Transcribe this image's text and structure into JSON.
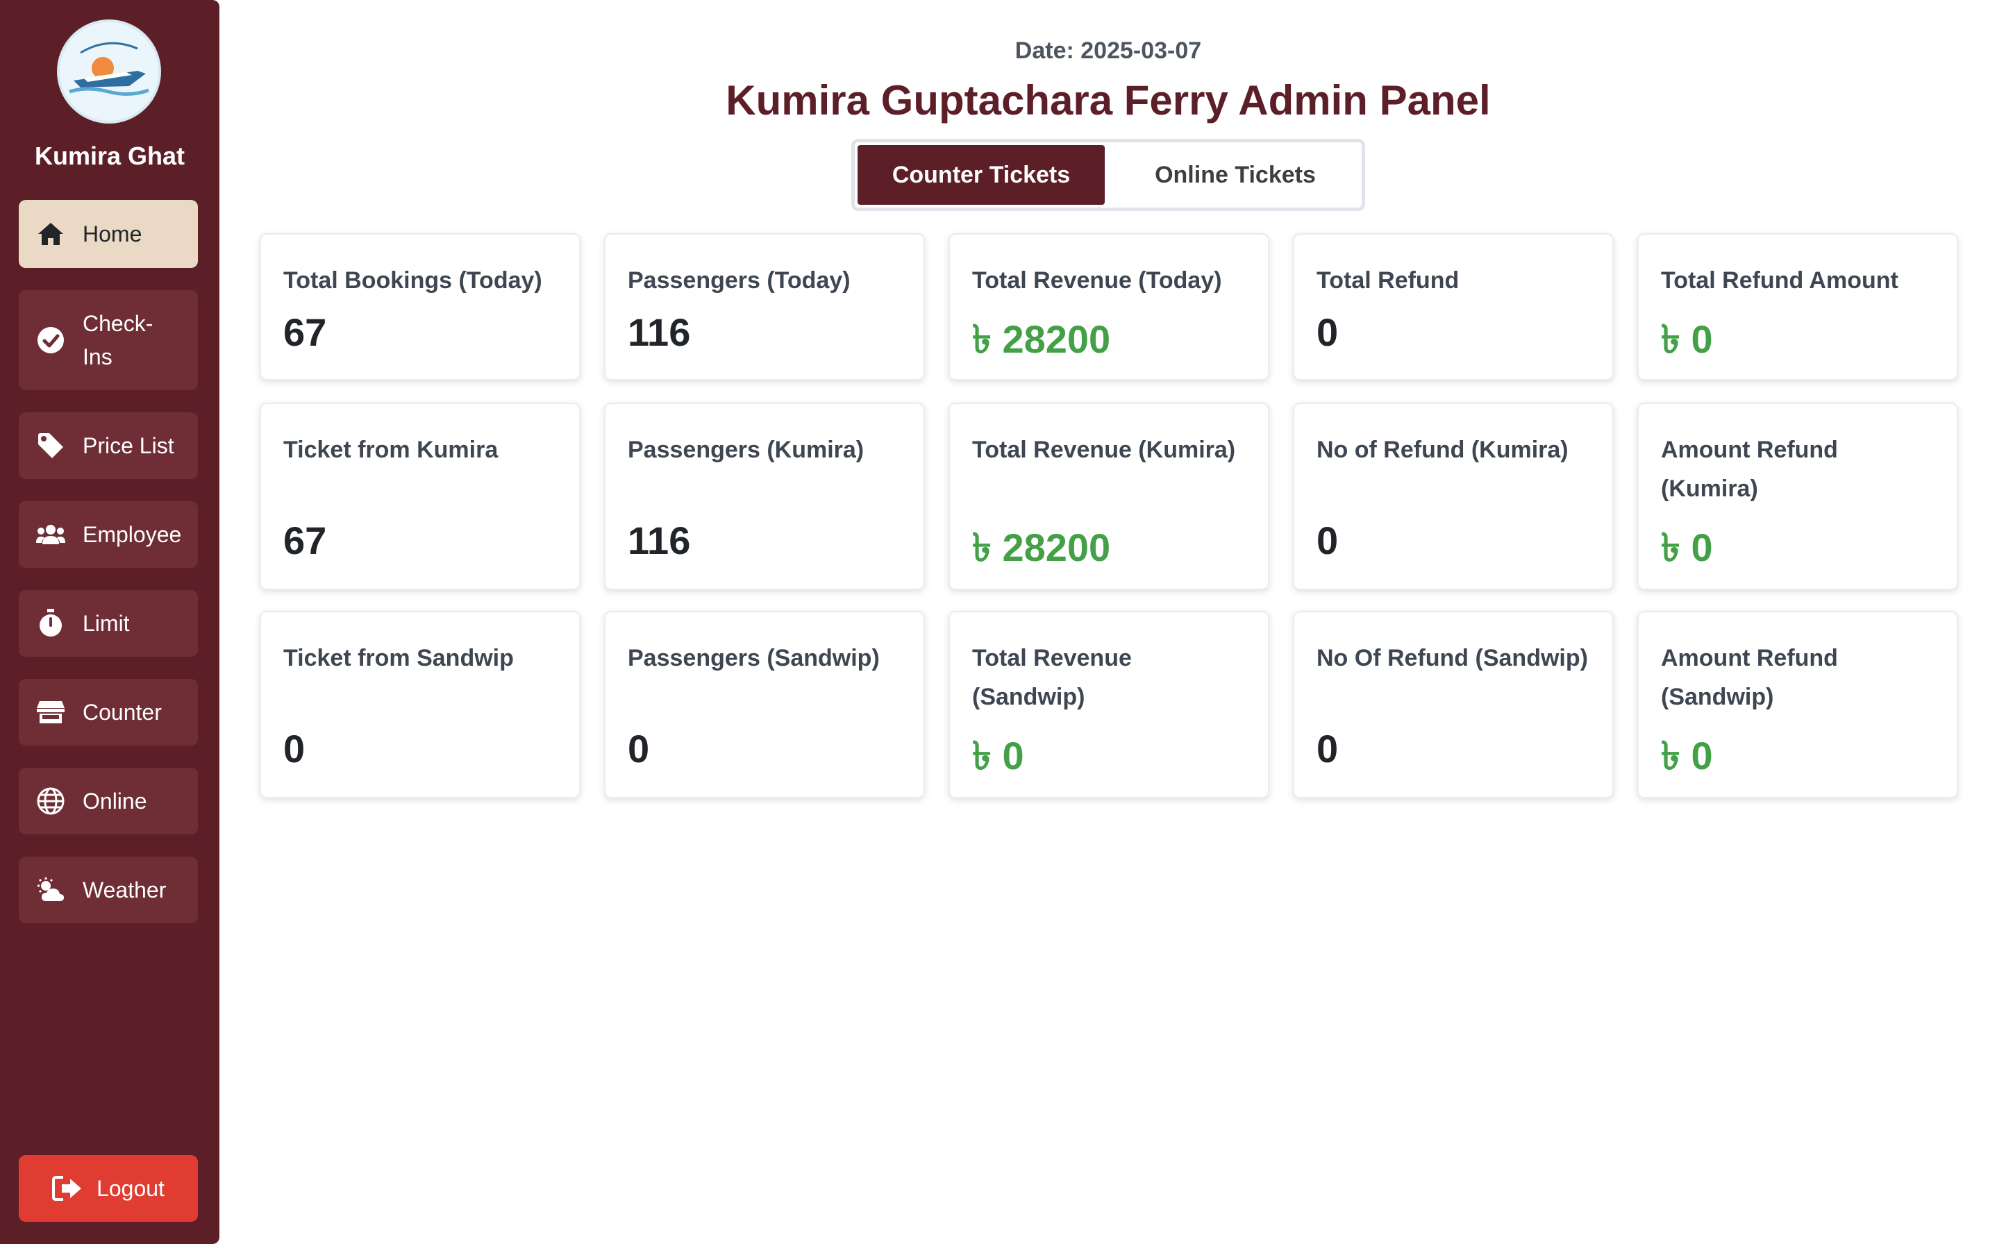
{
  "sidebar": {
    "brand": "Kumira Ghat",
    "logo_icon": "ferry-logo",
    "items": [
      {
        "label": "Home",
        "icon": "home-icon",
        "active": true
      },
      {
        "label": "Check-\nIns",
        "icon": "check-circle-icon",
        "active": false
      },
      {
        "label": "Price List",
        "icon": "tag-icon",
        "active": false
      },
      {
        "label": "Employee",
        "icon": "users-icon",
        "active": false
      },
      {
        "label": "Limit",
        "icon": "stopwatch-icon",
        "active": false
      },
      {
        "label": "Counter",
        "icon": "store-icon",
        "active": false
      },
      {
        "label": "Online",
        "icon": "globe-icon",
        "active": false
      },
      {
        "label": "Weather",
        "icon": "cloud-sun-icon",
        "active": false
      }
    ],
    "logout_label": "Logout"
  },
  "header": {
    "date": "Date: 2025-03-07",
    "title": "Kumira Guptachara Ferry Admin Panel"
  },
  "tabs": [
    {
      "label": "Counter Tickets",
      "active": true
    },
    {
      "label": "Online Tickets",
      "active": false
    }
  ],
  "currency_symbol": "৳",
  "colors": {
    "sidebar": "#5c1f27",
    "accent": "#5c1f27",
    "money": "#43a047",
    "logout": "#e03c31",
    "active_nav": "#ead9c5"
  },
  "stats": {
    "today": [
      {
        "label": "Total Bookings (Today)",
        "value": "67"
      },
      {
        "label": "Passengers (Today)",
        "value": "116"
      },
      {
        "label": "Total Revenue (Today)",
        "value": "৳ 28200"
      },
      {
        "label": "Total Refund",
        "value": "0"
      },
      {
        "label": "Total Refund Amount",
        "value": "৳ 0"
      }
    ],
    "kumira": [
      {
        "label": "Ticket from Kumira",
        "value": "67"
      },
      {
        "label": "Passengers (Kumira)",
        "value": "116"
      },
      {
        "label": "Total Revenue (Kumira)",
        "value": "৳ 28200"
      },
      {
        "label": "No of Refund (Kumira)",
        "value": "0"
      },
      {
        "label": "Amount Refund (Kumira)",
        "value": "৳ 0"
      }
    ],
    "sandwip": [
      {
        "label": "Ticket from Sandwip",
        "value": "0"
      },
      {
        "label": "Passengers (Sandwip)",
        "value": "0"
      },
      {
        "label": "Total Revenue (Sandwip)",
        "value": "৳ 0"
      },
      {
        "label": "No Of Refund (Sandwip)",
        "value": "0"
      },
      {
        "label": "Amount Refund (Sandwip)",
        "value": "৳ 0"
      }
    ]
  }
}
